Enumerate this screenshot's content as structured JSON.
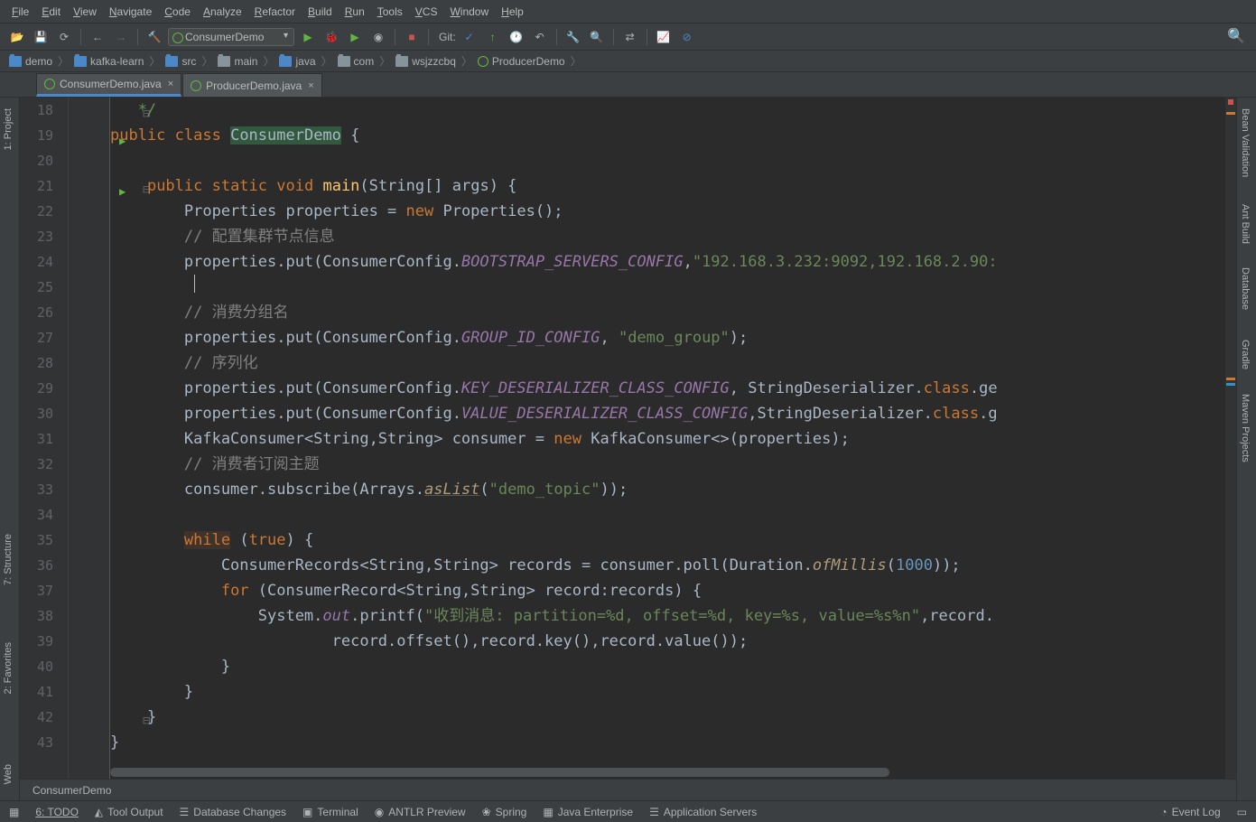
{
  "menu": [
    "File",
    "Edit",
    "View",
    "Navigate",
    "Code",
    "Analyze",
    "Refactor",
    "Build",
    "Run",
    "Tools",
    "VCS",
    "Window",
    "Help"
  ],
  "runConfig": "ConsumerDemo",
  "gitLabel": "Git:",
  "breadcrumbs": [
    {
      "icon": "folder-blue",
      "label": "demo"
    },
    {
      "icon": "folder-blue",
      "label": "kafka-learn"
    },
    {
      "icon": "folder-blue",
      "label": "src"
    },
    {
      "icon": "folder",
      "label": "main"
    },
    {
      "icon": "folder-blue",
      "label": "java"
    },
    {
      "icon": "folder",
      "label": "com"
    },
    {
      "icon": "folder",
      "label": "wsjzzcbq"
    },
    {
      "icon": "class",
      "label": "ProducerDemo"
    }
  ],
  "tabs": [
    {
      "label": "ConsumerDemo.java",
      "active": true,
      "icon": "class"
    },
    {
      "label": "ProducerDemo.java",
      "active": false,
      "icon": "class"
    }
  ],
  "leftSidebar": [
    "1: Project",
    "7: Structure",
    "2: Favorites",
    "Web"
  ],
  "rightSidebar": [
    "Bean Validation",
    "Ant Build",
    "Database",
    "Gradle",
    "Maven Projects"
  ],
  "bottomNav": "ConsumerDemo",
  "statusItems": [
    "6: TODO",
    "Tool Output",
    "Database Changes",
    "Terminal",
    "ANTLR Preview",
    "Spring",
    "Java Enterprise",
    "Application Servers"
  ],
  "statusRight": "Event Log",
  "code": {
    "startLine": 18,
    "lines": [
      {
        "n": 18,
        "fold": "-",
        "html": "   <span class='end-cmt'>*/</span>"
      },
      {
        "n": 19,
        "run": true,
        "html": "<span class='kw'>public class</span> <span class='clsname'>ConsumerDemo</span> {"
      },
      {
        "n": 20,
        "html": ""
      },
      {
        "n": 21,
        "run": true,
        "fold": "-",
        "html": "    <span class='kw'>public static</span> <span class='kw'>void</span> <span class='mname'>main</span>(String[] args) {"
      },
      {
        "n": 22,
        "html": "        Properties properties = <span class='kw'>new</span> Properties();"
      },
      {
        "n": 23,
        "html": "        <span class='cmt'>// 配置集群节点信息</span>"
      },
      {
        "n": 24,
        "html": "        properties.put(ConsumerConfig.<span class='static-f'>BOOTSTRAP_SERVERS_CONFIG</span>,<span class='str'>\"192.168.3.232:9092,192.168.2.90:</span>"
      },
      {
        "n": 25,
        "html": ""
      },
      {
        "n": 26,
        "html": "        <span class='cmt'>// 消费分组名</span>"
      },
      {
        "n": 27,
        "html": "        properties.put(ConsumerConfig.<span class='static-f'>GROUP_ID_CONFIG</span>, <span class='str'>\"demo_group\"</span>);"
      },
      {
        "n": 28,
        "html": "        <span class='cmt'>// 序列化</span>"
      },
      {
        "n": 29,
        "html": "        properties.put(ConsumerConfig.<span class='static-f'>KEY_DESERIALIZER_CLASS_CONFIG</span>, StringDeserializer.<span class='kw'>class</span>.ge"
      },
      {
        "n": 30,
        "html": "        properties.put(ConsumerConfig.<span class='static-f'>VALUE_DESERIALIZER_CLASS_CONFIG</span>,StringDeserializer.<span class='kw'>class</span>.g"
      },
      {
        "n": 31,
        "html": "        KafkaConsumer&lt;String,String&gt; consumer = <span class='kw'>new</span> KafkaConsumer&lt;&gt;(properties);"
      },
      {
        "n": 32,
        "html": "        <span class='cmt'>// 消费者订阅主题</span>"
      },
      {
        "n": 33,
        "html": "        consumer.subscribe(Arrays.<span class='static-m u-italic'>asList</span>(<span class='str'>\"demo_topic\"</span>));"
      },
      {
        "n": 34,
        "html": ""
      },
      {
        "n": 35,
        "html": "        <span class='kw-hl'>while</span> (<span class='kw'>true</span>) {"
      },
      {
        "n": 36,
        "html": "            ConsumerRecords&lt;String,String&gt; records = consumer.poll(Duration.<span class='static-m'>ofMillis</span>(<span class='num'>1000</span>));"
      },
      {
        "n": 37,
        "html": "            <span class='kw'>for</span> (ConsumerRecord&lt;String,String&gt; record:records) {"
      },
      {
        "n": 38,
        "html": "                System.<span class='static-f'>out</span>.printf(<span class='str'>\"收到消息: partition=%d, offset=%d, key=%s, value=%s%n\"</span>,record."
      },
      {
        "n": 39,
        "html": "                        record.offset(),record.key(),record.value());"
      },
      {
        "n": 40,
        "html": "            }"
      },
      {
        "n": 41,
        "html": "        }"
      },
      {
        "n": 42,
        "fold": "-",
        "html": "    }"
      },
      {
        "n": 43,
        "html": "}"
      }
    ]
  }
}
